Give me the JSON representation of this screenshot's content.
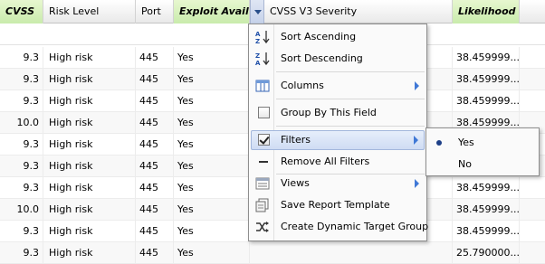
{
  "columns": [
    {
      "key": "cvss",
      "label": "CVSS"
    },
    {
      "key": "risk",
      "label": "Risk Level"
    },
    {
      "key": "port",
      "label": "Port"
    },
    {
      "key": "exploit",
      "label": "Exploit Availa"
    },
    {
      "key": "v3",
      "label": "CVSS V3 Severity"
    },
    {
      "key": "likelihood",
      "label": "Likelihood"
    }
  ],
  "rows": [
    {
      "cvss": "9.3",
      "risk": "High risk",
      "port": "445",
      "exploit": "Yes",
      "v3": "",
      "likelihood": "38.459999..."
    },
    {
      "cvss": "9.3",
      "risk": "High risk",
      "port": "445",
      "exploit": "Yes",
      "v3": "",
      "likelihood": "38.459999..."
    },
    {
      "cvss": "9.3",
      "risk": "High risk",
      "port": "445",
      "exploit": "Yes",
      "v3": "",
      "likelihood": "38.459999..."
    },
    {
      "cvss": "10.0",
      "risk": "High risk",
      "port": "445",
      "exploit": "Yes",
      "v3": "",
      "likelihood": "38.459999..."
    },
    {
      "cvss": "9.3",
      "risk": "High risk",
      "port": "445",
      "exploit": "Yes",
      "v3": "",
      "likelihood": "38.459999..."
    },
    {
      "cvss": "9.3",
      "risk": "High risk",
      "port": "445",
      "exploit": "Yes",
      "v3": "",
      "likelihood": "38.459999..."
    },
    {
      "cvss": "9.3",
      "risk": "High risk",
      "port": "445",
      "exploit": "Yes",
      "v3": "",
      "likelihood": "38.459999..."
    },
    {
      "cvss": "10.0",
      "risk": "High risk",
      "port": "445",
      "exploit": "Yes",
      "v3": "",
      "likelihood": "38.459999..."
    },
    {
      "cvss": "9.3",
      "risk": "High risk",
      "port": "445",
      "exploit": "Yes",
      "v3": "",
      "likelihood": "38.459999..."
    },
    {
      "cvss": "9.3",
      "risk": "High risk",
      "port": "445",
      "exploit": "Yes",
      "v3": "",
      "likelihood": "25.790000..."
    }
  ],
  "menu": {
    "sort_asc": {
      "label": "Sort Ascending",
      "icon": "sort-ascending-icon"
    },
    "sort_desc": {
      "label": "Sort Descending",
      "icon": "sort-descending-icon"
    },
    "columns": {
      "label": "Columns",
      "icon": "columns-icon"
    },
    "group_by": {
      "label": "Group By This Field",
      "icon": "checkbox-icon"
    },
    "filters": {
      "label": "Filters",
      "icon": "checkbox-checked-icon"
    },
    "remove_filters": {
      "label": "Remove All Filters",
      "icon": "minus-icon"
    },
    "views": {
      "label": "Views",
      "icon": "views-icon"
    },
    "save_template": {
      "label": "Save Report Template",
      "icon": "save-template-icon"
    },
    "dynamic_group": {
      "label": "Create Dynamic Target Group",
      "icon": "shuffle-icon"
    }
  },
  "filters_submenu": {
    "options": [
      {
        "label": "Yes",
        "selected": true
      },
      {
        "label": "No",
        "selected": false
      }
    ]
  },
  "colors": {
    "header_highlight": "#c9ebac",
    "menu_active": "#cfdcf3",
    "submenu_arrow": "#3f78d6",
    "selected_dot": "#1d3f87"
  }
}
